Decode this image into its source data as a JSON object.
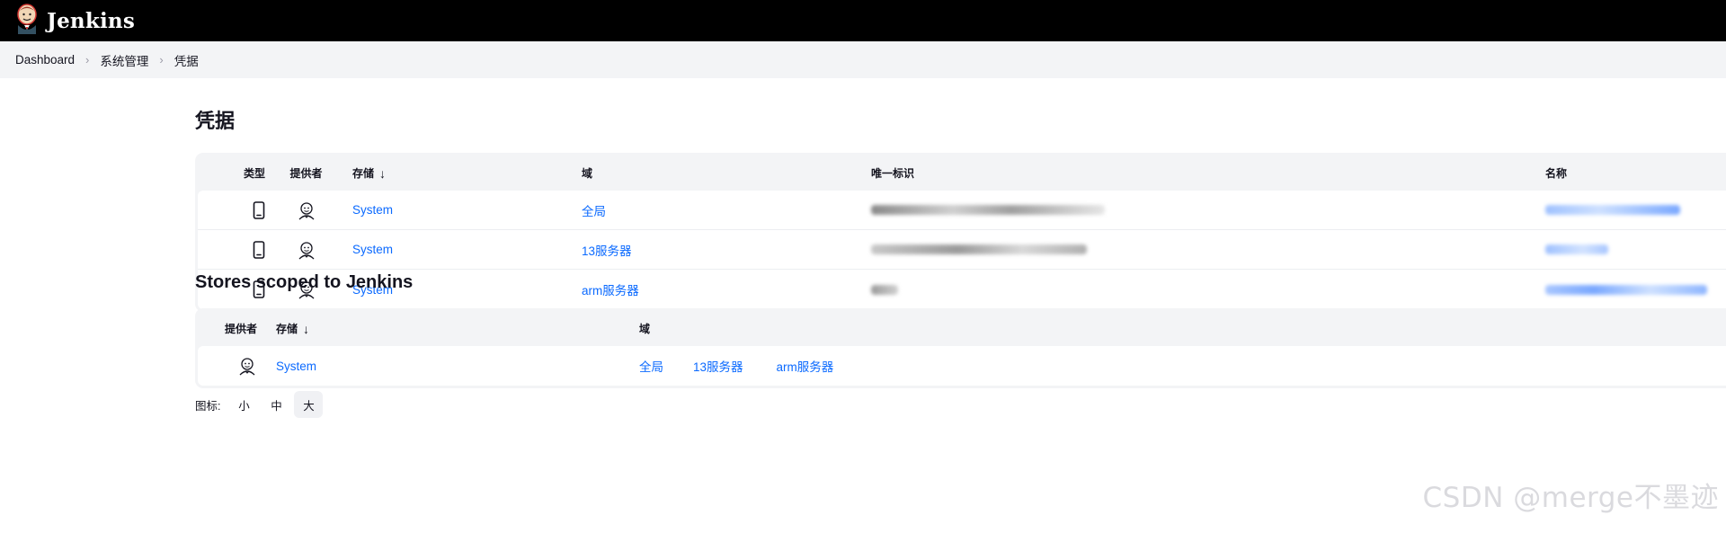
{
  "header": {
    "app_name": "Jenkins",
    "logo_icon": "jenkins-butler-icon"
  },
  "breadcrumb": {
    "items": [
      "Dashboard",
      "系统管理",
      "凭据"
    ]
  },
  "credentials": {
    "title": "凭据",
    "columns": {
      "type": "类型",
      "provider": "提供者",
      "store": "存储",
      "store_sort": "↓",
      "domain": "域",
      "id": "唯一标识",
      "name": "名称"
    },
    "rows": [
      {
        "store": "System",
        "domain": "全局",
        "id_obscured": true,
        "name_obscured": true
      },
      {
        "store": "System",
        "domain": "13服务器",
        "id_obscured": true,
        "name_obscured": true
      },
      {
        "store": "System",
        "domain": "arm服务器",
        "id_obscured": true,
        "name_obscured": true
      }
    ],
    "type_icon": "mobile-device-icon",
    "provider_icon": "jenkins-user-icon"
  },
  "stores": {
    "title": "Stores scoped to Jenkins",
    "columns": {
      "provider": "提供者",
      "store": "存储",
      "store_sort": "↓",
      "domain": "域"
    },
    "rows": [
      {
        "store": "System",
        "domains": [
          "全局",
          "13服务器",
          "arm服务器"
        ]
      }
    ]
  },
  "icon_size": {
    "label": "图标:",
    "options": [
      "小",
      "中",
      "大"
    ],
    "selected": "大"
  },
  "watermark": "CSDN @merge不墨迹",
  "colors": {
    "link": "#0b6aff",
    "header_bg": "#000000",
    "crumb_bg": "#f3f4f6"
  }
}
